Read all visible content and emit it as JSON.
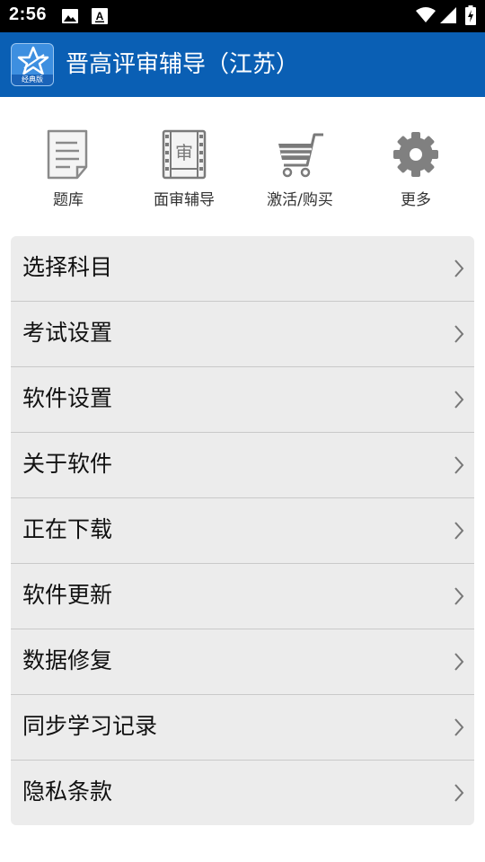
{
  "status_bar": {
    "time": "2:56",
    "icons": [
      "image-icon",
      "keyboard-a-icon",
      "wifi-icon",
      "signal-icon",
      "battery-charging-icon"
    ],
    "badge": "A"
  },
  "app_bar": {
    "title": "晋高评审辅导（江苏）",
    "logo_tag": "经典版",
    "color": "#0a5fb4"
  },
  "quick_actions": [
    {
      "label": "题库",
      "icon": "document-icon"
    },
    {
      "label": "面审辅导",
      "icon": "film-review-icon",
      "icon_text": "审"
    },
    {
      "label": "激活/购买",
      "icon": "shopping-cart-icon"
    },
    {
      "label": "更多",
      "icon": "gear-icon"
    }
  ],
  "menu": {
    "items": [
      {
        "label": "选择科目"
      },
      {
        "label": "考试设置"
      },
      {
        "label": "软件设置"
      },
      {
        "label": "关于软件"
      },
      {
        "label": "正在下载"
      },
      {
        "label": "软件更新"
      },
      {
        "label": "数据修复"
      },
      {
        "label": "同步学习记录"
      },
      {
        "label": "隐私条款"
      }
    ]
  }
}
